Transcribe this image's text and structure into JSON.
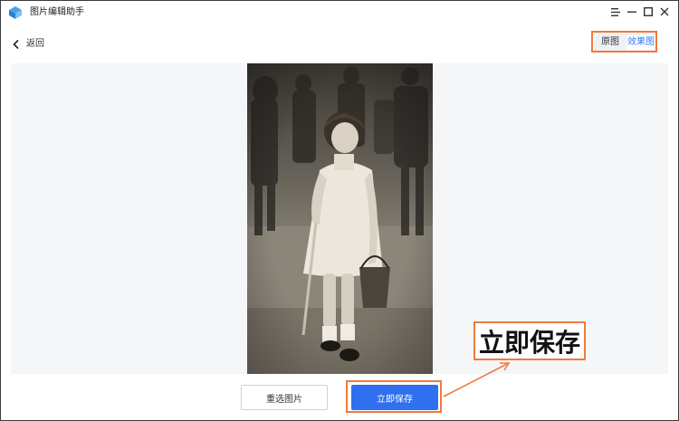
{
  "app": {
    "title": "图片编辑助手",
    "logo_icon": "app-logo-icon"
  },
  "window_controls": {
    "menu_icon": "menu-icon",
    "minimize_icon": "minimize-icon",
    "maximize_icon": "maximize-icon",
    "close_icon": "close-icon"
  },
  "header": {
    "back_label": "返回",
    "toggle": {
      "original_label": "原图",
      "effect_label": "效果图",
      "active": "effect"
    }
  },
  "preview": {
    "image_description_icon": "photo-preview"
  },
  "footer": {
    "reselect_label": "重选图片",
    "save_label": "立即保存"
  },
  "annotation": {
    "callout_text": "立即保存"
  },
  "colors": {
    "accent": "#2f6ff0",
    "highlight": "#f07a3e",
    "toggle_active_text": "#2f7af0",
    "canvas_bg": "#f5f6f8"
  }
}
